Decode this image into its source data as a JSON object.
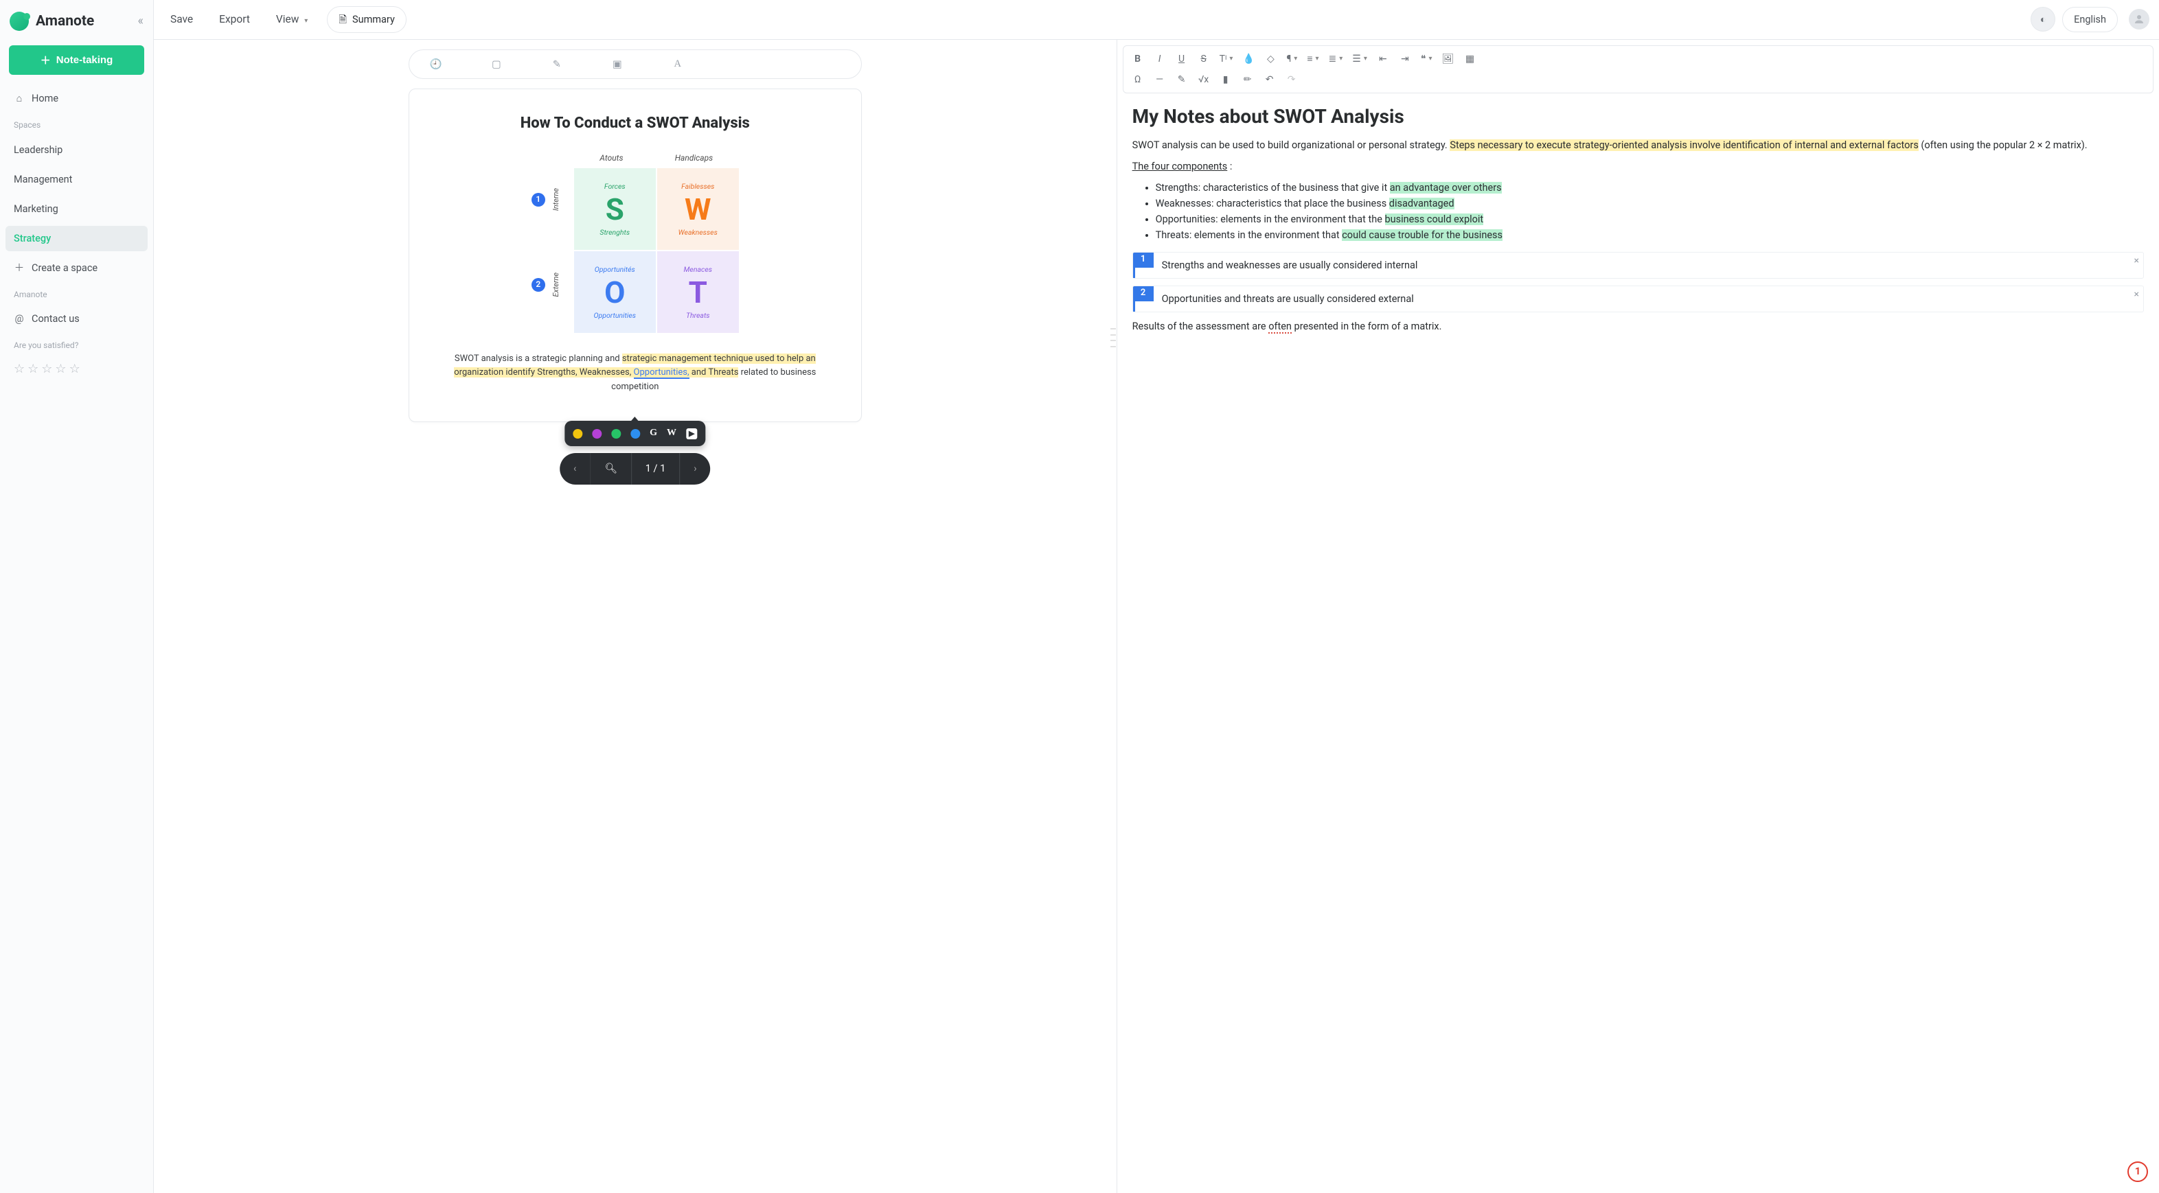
{
  "brand": {
    "name": "Amanote"
  },
  "sidebar": {
    "main_action": "Note-taking",
    "home": "Home",
    "spaces_label": "Spaces",
    "spaces": [
      {
        "label": "Leadership",
        "active": false
      },
      {
        "label": "Management",
        "active": false
      },
      {
        "label": "Marketing",
        "active": false
      },
      {
        "label": "Strategy",
        "active": true
      }
    ],
    "create_space": "Create a space",
    "brand_label": "Amanote",
    "contact": "Contact us",
    "satisfied": "Are you satisfied?"
  },
  "topbar": {
    "save": "Save",
    "export": "Export",
    "view": "View",
    "summary": "Summary",
    "language": "English"
  },
  "document": {
    "title": "How To Conduct a SWOT Analysis",
    "col_atouts": "Atouts",
    "col_handicaps": "Handicaps",
    "row_interne": "Interne",
    "row_externe": "Externe",
    "cells": {
      "s_top": "Forces",
      "s_big": "S",
      "s_bot": "Strenghts",
      "w_top": "Faiblesses",
      "w_big": "W",
      "w_bot": "Weaknesses",
      "o_top": "Opportunités",
      "o_big": "O",
      "o_bot": "Opportunities",
      "t_top": "Menaces",
      "t_big": "T",
      "t_bot": "Threats"
    },
    "caption_pre": "SWOT analysis is a strategic planning and ",
    "caption_hl1": "strategic management technique used to help an organization identify Strengths, Weaknesses, ",
    "caption_sel": "Opportunities,",
    "caption_hl2": " and Threats",
    "caption_post": " related to business competition",
    "lookup": {
      "g": "G",
      "w": "W",
      "yt": "▶"
    },
    "pager": {
      "label": "1 / 1"
    }
  },
  "notes": {
    "title": "My Notes about SWOT Analysis",
    "p1_a": "SWOT analysis can be used to build organizational or personal strategy. ",
    "p1_hl": "Steps necessary to execute strategy-oriented analysis involve identification of internal and external factors",
    "p1_b": " (often using the popular 2 × 2 matrix).",
    "p2_u": "The four components",
    "p2_colon": " :",
    "bullets": [
      {
        "pre": "Strengths: characteristics of the business that give it ",
        "hl": "an advantage over others",
        "post": ""
      },
      {
        "pre": "Weaknesses: characteristics that place the business ",
        "hl": "disadvantaged",
        "post": ""
      },
      {
        "pre": "Opportunities: elements in the environment that the ",
        "hl": "business could exploit",
        "post": ""
      },
      {
        "pre": "Threats: elements in the environment that ",
        "hl": "could cause trouble for the business",
        "post": ""
      }
    ],
    "ref1": {
      "num": "1",
      "text": "Strengths and weaknesses are usually considered internal"
    },
    "ref2": {
      "num": "2",
      "text": "Opportunities and threats are usually considered external"
    },
    "p3_a": "Results of the assessment are ",
    "p3_sq": "often",
    "p3_b": " presented in the form of a matrix."
  },
  "badge": "1"
}
